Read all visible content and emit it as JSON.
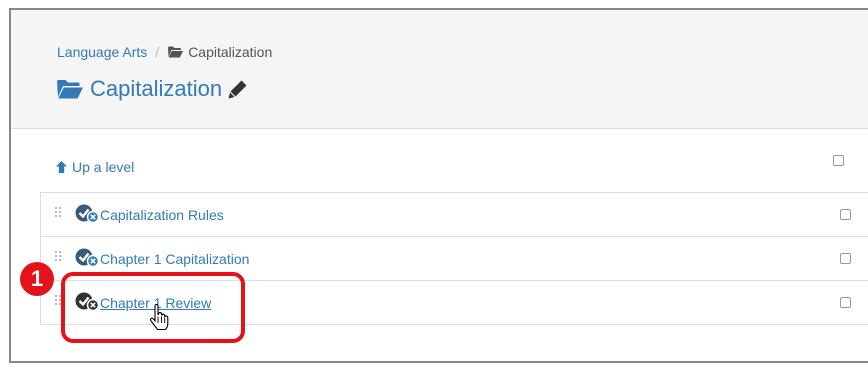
{
  "breadcrumb": {
    "parent": "Language Arts",
    "separator": "/",
    "current": "Capitalization"
  },
  "page": {
    "title": "Capitalization"
  },
  "up_level": {
    "label": "Up a level"
  },
  "items": [
    {
      "label": "Capitalization Rules"
    },
    {
      "label": "Chapter 1 Capitalization"
    },
    {
      "label": "Chapter 1 Review"
    }
  ],
  "callout": {
    "number": "1"
  },
  "icons": {
    "breadcrumb": "folder-open-icon",
    "title": "folder-open-icon",
    "edit": "pencil-icon",
    "up": "arrow-up-icon",
    "drag": "drag-handle-icon",
    "status": "check-circle-icon",
    "cursor": "hand-pointer-icon"
  },
  "colors": {
    "link": "#337ab7",
    "header_bg": "#f5f5f5",
    "highlight": "#e3121b",
    "status_icon": "#3c5a78"
  }
}
